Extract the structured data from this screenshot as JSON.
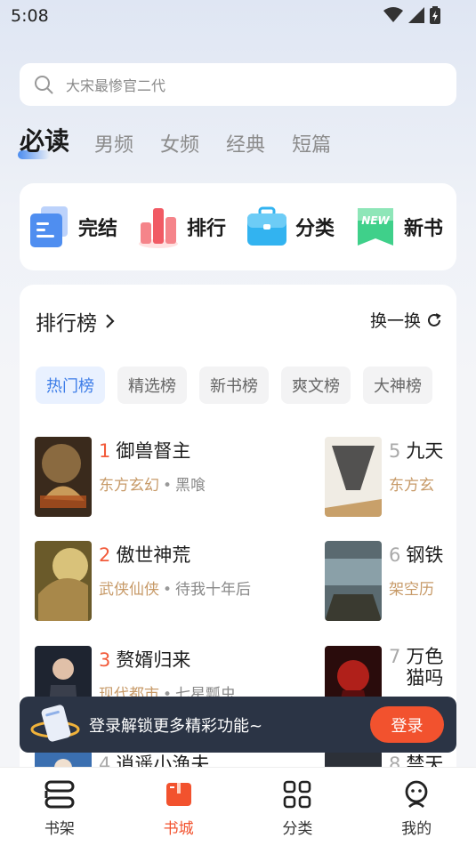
{
  "status": {
    "time": "5:08"
  },
  "search": {
    "placeholder": "大宋最惨官二代"
  },
  "tabs": [
    {
      "label": "必读",
      "active": true
    },
    {
      "label": "男频"
    },
    {
      "label": "女频"
    },
    {
      "label": "经典"
    },
    {
      "label": "短篇"
    }
  ],
  "quick": [
    {
      "label": "完结",
      "icon": "book-complete-icon"
    },
    {
      "label": "排行",
      "icon": "ranking-chart-icon"
    },
    {
      "label": "分类",
      "icon": "category-folder-icon"
    },
    {
      "label": "新书",
      "icon": "new-badge-icon",
      "badge_text": "NEW"
    }
  ],
  "ranking": {
    "title": "排行榜",
    "refresh": "换一换",
    "chips": [
      {
        "label": "热门榜",
        "active": true
      },
      {
        "label": "精选榜"
      },
      {
        "label": "新书榜"
      },
      {
        "label": "爽文榜"
      },
      {
        "label": "大神榜"
      }
    ],
    "books": [
      {
        "rank": "1",
        "title": "御兽督主",
        "genre": "东方玄幻",
        "author": "黑喰"
      },
      {
        "rank": "2",
        "title": "傲世神荒",
        "genre": "武侠仙侠",
        "author": "待我十年后"
      },
      {
        "rank": "3",
        "title": "赘婿归来",
        "genre": "现代都市",
        "author": "七星瓢虫"
      },
      {
        "rank": "4",
        "title": "逍遥小渔夫",
        "genre": "",
        "author": ""
      },
      {
        "rank": "5",
        "title": "九天",
        "genre": "东方玄",
        "author": ""
      },
      {
        "rank": "6",
        "title": "钢铁",
        "genre": "架空历",
        "author": ""
      },
      {
        "rank": "7",
        "title": "万色猫吗",
        "genre": "",
        "author": ""
      },
      {
        "rank": "8",
        "title": "禁天",
        "genre": "",
        "author": ""
      }
    ]
  },
  "login_banner": {
    "text": "登录解锁更多精彩功能~",
    "button": "登录"
  },
  "bottom_nav": [
    {
      "label": "书架",
      "icon": "bookshelf-icon"
    },
    {
      "label": "书城",
      "icon": "bookstore-icon",
      "active": true
    },
    {
      "label": "分类",
      "icon": "grid-category-icon"
    },
    {
      "label": "我的",
      "icon": "profile-icon"
    }
  ],
  "colors": {
    "accent": "#f2522e",
    "blue": "#3d7de8",
    "genre": "#c79a68"
  }
}
